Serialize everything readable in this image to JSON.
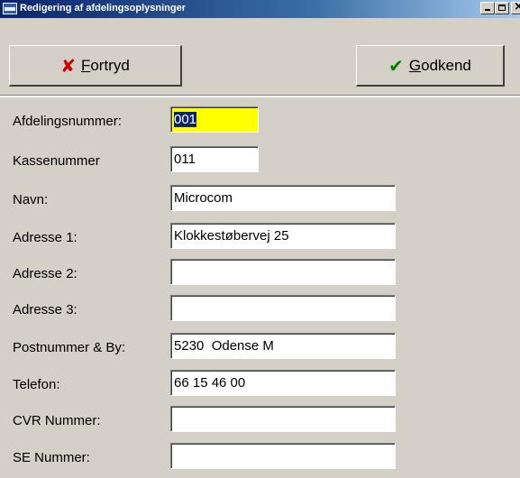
{
  "window": {
    "title": "Redigering af afdelingsoplysninger"
  },
  "toolbar": {
    "cancel_prefix": "F",
    "cancel_rest": "ortryd",
    "ok_prefix": "G",
    "ok_rest": "odkend",
    "cancel_icon": "x-icon",
    "ok_icon": "check-icon",
    "cancel_icon_color": "#cc0000",
    "ok_icon_color": "#008000"
  },
  "form": {
    "fields": [
      {
        "label": "Afdelingsnummer:",
        "value": "001",
        "focused": true
      },
      {
        "label": "Kassenummer",
        "value": "011"
      },
      {
        "label": "Navn:",
        "value": "Microcom"
      },
      {
        "label": "Adresse 1:",
        "value": "Klokkestøbervej 25"
      },
      {
        "label": "Adresse 2:",
        "value": ""
      },
      {
        "label": "Adresse 3:",
        "value": ""
      },
      {
        "label": "Postnummer & By:",
        "value": "5230  Odense M"
      },
      {
        "label": "Telefon:",
        "value": "66 15 46 00"
      },
      {
        "label": "CVR Nummer:",
        "value": ""
      },
      {
        "label": "SE Nummer:",
        "value": ""
      }
    ]
  },
  "colors": {
    "focus_highlight": "#ffff00",
    "selection": "#0a246a",
    "face": "#d4d0c8"
  }
}
